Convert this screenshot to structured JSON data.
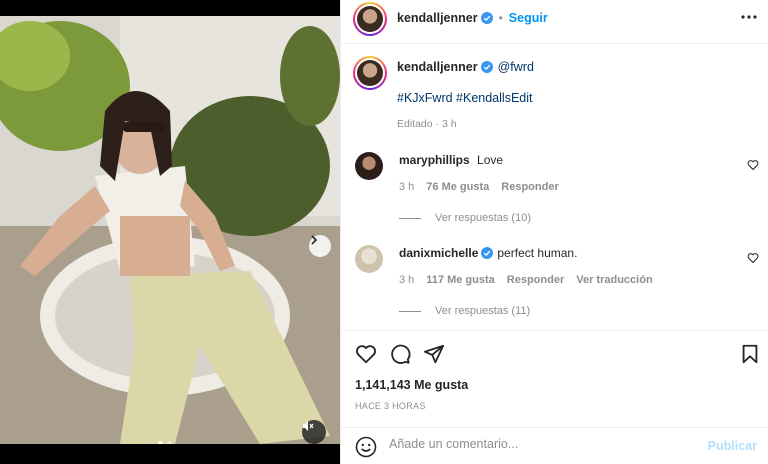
{
  "post": {
    "author": "kendalljenner",
    "follow_label": "Seguir",
    "more_icon": "more-options-icon"
  },
  "caption": {
    "author": "kendalljenner",
    "mention": "@fwrd",
    "hashtags": "#KJxFwrd #KendallsEdit",
    "edited": "Editado · 3 h"
  },
  "comments": [
    {
      "user": "maryphillips",
      "text": "Love",
      "time": "3 h",
      "likes": "76 Me gusta",
      "reply": "Responder",
      "translate": "",
      "view_replies": "Ver respuestas (10)",
      "verified": false
    },
    {
      "user": "danixmichelle",
      "text": "perfect human.",
      "time": "3 h",
      "likes": "117 Me gusta",
      "reply": "Responder",
      "translate": "Ver traducción",
      "view_replies": "Ver respuestas (11)",
      "verified": true
    }
  ],
  "stats": {
    "likes": "1,141,143 Me gusta",
    "time": "HACE 3 HORAS"
  },
  "comment_box": {
    "placeholder": "Añade un comentario...",
    "publish": "Publicar"
  },
  "carousel": {
    "current": 1,
    "total": 2
  },
  "colors": {
    "accent": "#0095f6",
    "publish_disabled": "#b2dffc",
    "verified": "#3897f0"
  }
}
